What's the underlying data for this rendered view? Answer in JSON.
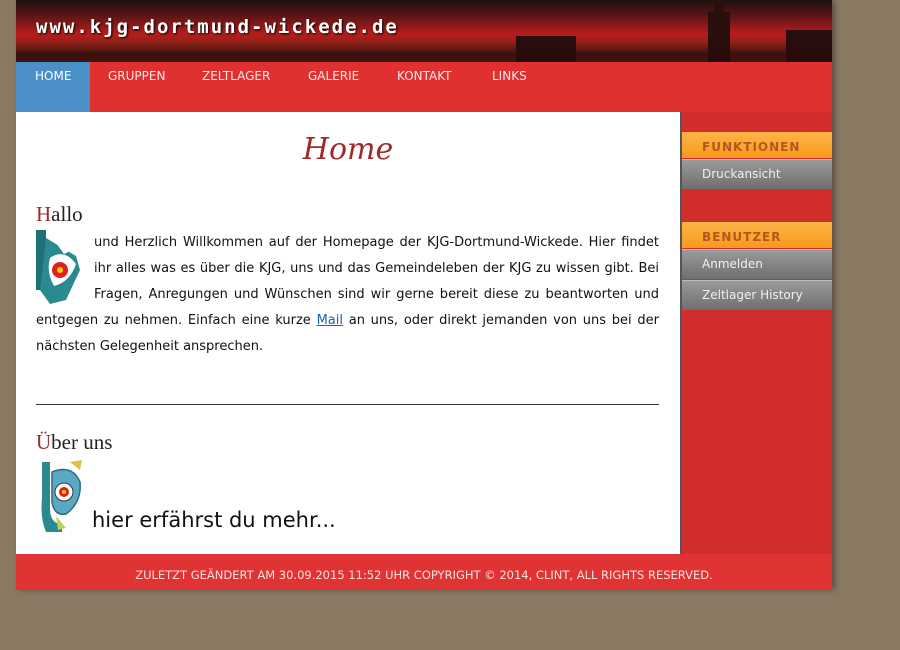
{
  "header": {
    "site_title": "www.kjg-dortmund-wickede.de"
  },
  "nav": {
    "items": [
      {
        "label": "HOME"
      },
      {
        "label": "GRUPPEN"
      },
      {
        "label": "ZELTLAGER"
      },
      {
        "label": "GALERIE"
      },
      {
        "label": "KONTAKT"
      },
      {
        "label": "LINKS"
      }
    ],
    "active": "HOME"
  },
  "main": {
    "page_title": "Home",
    "hallo": {
      "heading_first": "H",
      "heading_rest": "allo",
      "text_before_link": "und Herzlich Willkommen auf der Homepage der KJG-Dortmund-Wickede. Hier findet ihr alles was es über die KJG, uns und das Gemeindeleben der KJG zu wissen gibt. Bei Fragen, Anregungen und Wünschen sind wir gerne bereit diese zu beantworten und entgegen zu nehmen. Einfach eine kurze ",
      "link_text": "Mail",
      "text_after_link": " an uns, oder direkt jemanden von uns bei der nächsten Gelegenheit ansprechen."
    },
    "about": {
      "heading_first": "Ü",
      "heading_rest": "ber uns",
      "link_text": "hier erfährst du mehr..."
    }
  },
  "sidebar": {
    "funktionen": {
      "heading": "FUNKTIONEN",
      "items": [
        "Druckansicht"
      ]
    },
    "benutzer": {
      "heading": "BENUTZER",
      "items": [
        "Anmelden",
        "Zeltlager History"
      ]
    }
  },
  "footer": {
    "text": "ZULETZT GEÄNDERT AM 30.09.2015 11:52 UHR COPYRIGHT © 2014, CLINT, ALL RIGHTS RESERVED."
  },
  "colors": {
    "accent_red": "#e03030",
    "nav_active": "#4a8fc7",
    "sidebar_heading": "#f59a1c",
    "title_red": "#a0292b"
  }
}
